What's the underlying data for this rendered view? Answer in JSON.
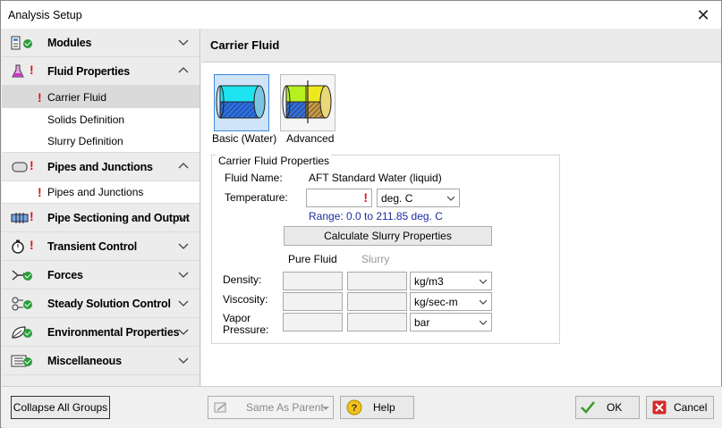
{
  "window": {
    "title": "Analysis Setup"
  },
  "sidebar": {
    "groups": [
      {
        "label": "Modules"
      },
      {
        "label": "Fluid Properties",
        "items": [
          {
            "label": "Carrier Fluid"
          },
          {
            "label": "Solids Definition"
          },
          {
            "label": "Slurry Definition"
          }
        ]
      },
      {
        "label": "Pipes and Junctions",
        "items": [
          {
            "label": "Pipes and Junctions"
          }
        ]
      },
      {
        "label": "Pipe Sectioning and Output"
      },
      {
        "label": "Transient Control"
      },
      {
        "label": "Forces"
      },
      {
        "label": "Steady Solution Control"
      },
      {
        "label": "Environmental Properties"
      },
      {
        "label": "Miscellaneous"
      }
    ]
  },
  "main": {
    "header": "Carrier Fluid",
    "fluid_types": [
      {
        "label": "Basic (Water)"
      },
      {
        "label": "Advanced"
      }
    ],
    "properties": {
      "legend": "Carrier Fluid Properties",
      "fluid_name_label": "Fluid Name:",
      "fluid_name_value": "AFT Standard Water (liquid)",
      "temperature_label": "Temperature:",
      "temperature_value": "",
      "temperature_unit": "deg. C",
      "range_text": "Range: 0.0 to 211.85 deg. C",
      "calc_button": "Calculate Slurry Properties",
      "col_pure": "Pure Fluid",
      "col_slurry": "Slurry",
      "density_label": "Density:",
      "density_unit": "kg/m3",
      "viscosity_label": "Viscosity:",
      "viscosity_unit": "kg/sec-m",
      "vapor_label_1": "Vapor",
      "vapor_label_2": "Pressure:",
      "vapor_unit": "bar"
    }
  },
  "footer": {
    "collapse_button": "Collapse All Groups",
    "same_as_parent": "Same As Parent",
    "help_button": "Help",
    "ok_button": "OK",
    "cancel_button": "Cancel"
  },
  "colors": {
    "warning": "#d8141c",
    "ok": "#2a9d3a",
    "range_text": "#1a2ea0"
  }
}
